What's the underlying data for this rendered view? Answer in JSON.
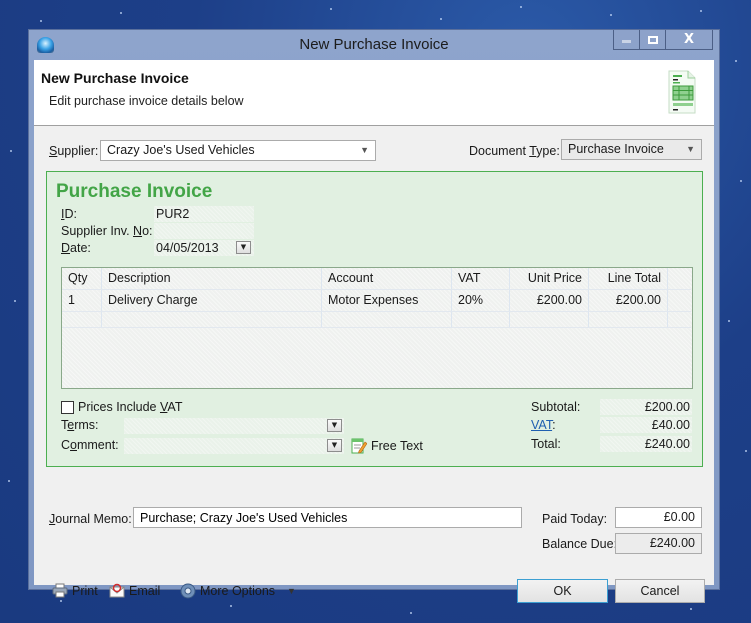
{
  "window": {
    "title": "New Purchase Invoice",
    "controls": {
      "minimize": "minimize",
      "maximize": "maximize",
      "close": "X"
    }
  },
  "header": {
    "title": "New Purchase Invoice",
    "subtitle": "Edit purchase invoice details below",
    "icon": "invoice-document-icon"
  },
  "supplier": {
    "label": "Supplier:",
    "value": "Crazy Joe's Used Vehicles"
  },
  "document_type": {
    "label": "Document Type:",
    "value": "Purchase Invoice"
  },
  "invoice": {
    "heading": "Purchase Invoice",
    "id_label": "ID:",
    "id_value": "PUR2",
    "supplier_inv_label": "Supplier Inv. No:",
    "supplier_inv_value": "",
    "date_label": "Date:",
    "date_value": "04/05/2013"
  },
  "lines": {
    "columns": [
      "Qty",
      "Description",
      "Account",
      "VAT",
      "Unit Price",
      "Line Total"
    ],
    "rows": [
      {
        "qty": "1",
        "description": "Delivery Charge",
        "account": "Motor Expenses",
        "vat": "20%",
        "unit_price": "£200.00",
        "line_total": "£200.00"
      }
    ]
  },
  "options": {
    "prices_include_vat_label": "Prices Include VAT",
    "prices_include_vat_checked": false,
    "terms_label": "Terms:",
    "terms_value": "",
    "comment_label": "Comment:",
    "comment_value": "",
    "free_text_label": "Free Text"
  },
  "totals": {
    "subtotal_label": "Subtotal:",
    "subtotal_value": "£200.00",
    "vat_label": "VAT",
    "vat_value": "£40.00",
    "total_label": "Total:",
    "total_value": "£240.00"
  },
  "journal": {
    "label": "Journal Memo:",
    "value": "Purchase; Crazy Joe's Used Vehicles"
  },
  "payment": {
    "paid_today_label": "Paid Today:",
    "paid_today_value": "£0.00",
    "balance_due_label": "Balance Due:",
    "balance_due_value": "£240.00"
  },
  "footer": {
    "print_label": "Print",
    "email_label": "Email",
    "more_options_label": "More Options",
    "ok_label": "OK",
    "cancel_label": "Cancel"
  }
}
